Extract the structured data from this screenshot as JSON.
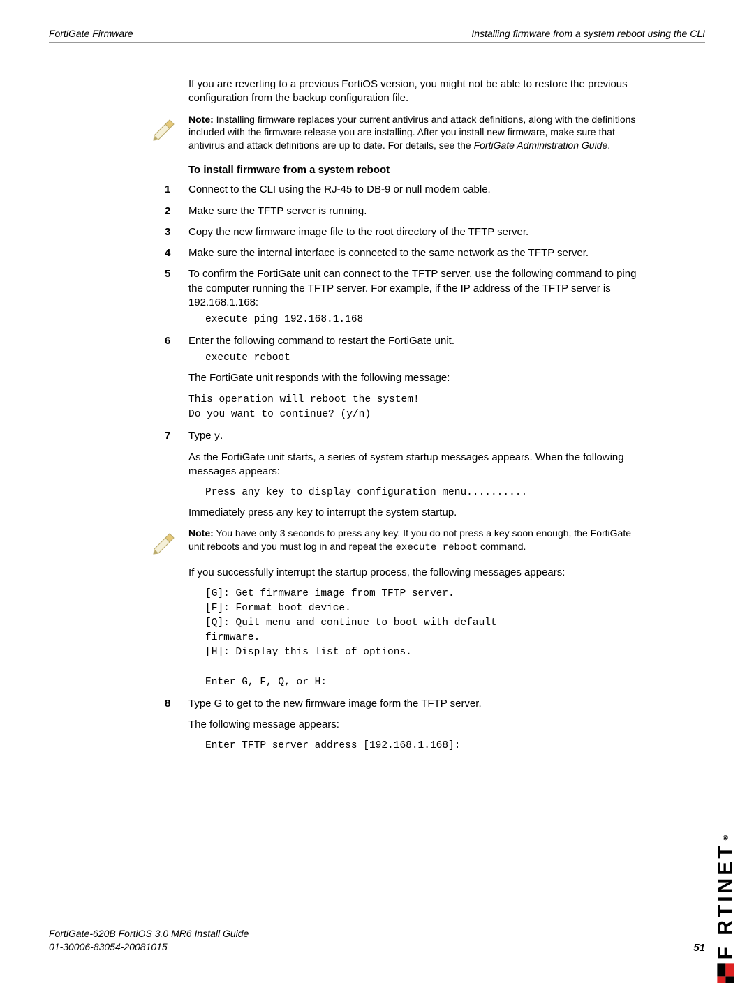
{
  "header": {
    "left": "FortiGate Firmware",
    "right": "Installing firmware from a system reboot using the CLI"
  },
  "intro": "If you are reverting to a previous FortiOS version, you might not be able to restore the previous configuration from the backup configuration file.",
  "note1": {
    "label": "Note:",
    "text": " Installing firmware replaces your current antivirus and attack definitions, along with the definitions included with the firmware release you are installing. After you install new firmware, make sure that antivirus and attack definitions are up to date. For details, see the ",
    "guide": "FortiGate Administration Guide",
    "tail": "."
  },
  "section_head": "To install firmware from a system reboot",
  "steps": {
    "s1": "Connect to the CLI using the RJ-45 to DB-9 or null modem cable.",
    "s2": "Make sure the TFTP server is running.",
    "s3": "Copy the new firmware image file to the root directory of the TFTP server.",
    "s4": "Make sure the internal interface is connected to the same network as the TFTP server.",
    "s5_intro": "To confirm the FortiGate unit can connect to the TFTP server, use the following command to ping the computer running the TFTP server. For example, if the IP address of the TFTP server is 192.168.1.168:",
    "s5_code": "execute ping 192.168.1.168",
    "s6_intro": "Enter the following command to restart the FortiGate unit.",
    "s6_code": "execute reboot",
    "s6_after": "The FortiGate unit responds with the following message:",
    "s6_msg": "This operation will reboot the system!\nDo you want to continue? (y/n)",
    "s7_intro_a": "Type ",
    "s7_y": "y",
    "s7_intro_b": ".",
    "s7_after": "As the FortiGate unit starts, a series of system startup messages appears. When the following messages appears:",
    "s7_msg": "Press any key to display configuration menu..........",
    "s7_tail": "Immediately press any key to interrupt the system startup.",
    "s8_intro": "Type G to get to the new firmware image form the TFTP server.",
    "s8_after": "The following message appears:",
    "s8_msg": "Enter TFTP server address [192.168.1.168]:"
  },
  "note2": {
    "label": "Note:",
    "part1": " You have only 3 seconds to press any key. If you do not press a key soon enough, the ",
    "fg": "FortiGate",
    "part2": " unit reboots and you must log in and repeat the ",
    "cmd": "execute reboot",
    "part3": " command."
  },
  "midpara": "If you successfully interrupt the startup process, the following messages appears:",
  "menu_code": "[G]: Get firmware image from TFTP server.\n[F]: Format boot device.\n[Q]: Quit menu and continue to boot with default\nfirmware.\n[H]: Display this list of options.\n\nEnter G, F, Q, or H:",
  "footer": {
    "line1": "FortiGate-620B FortiOS 3.0 MR6 Install Guide",
    "line2": "01-30006-83054-20081015",
    "page": "51"
  },
  "brand": "F    RTINET",
  "brand_reg": "®"
}
